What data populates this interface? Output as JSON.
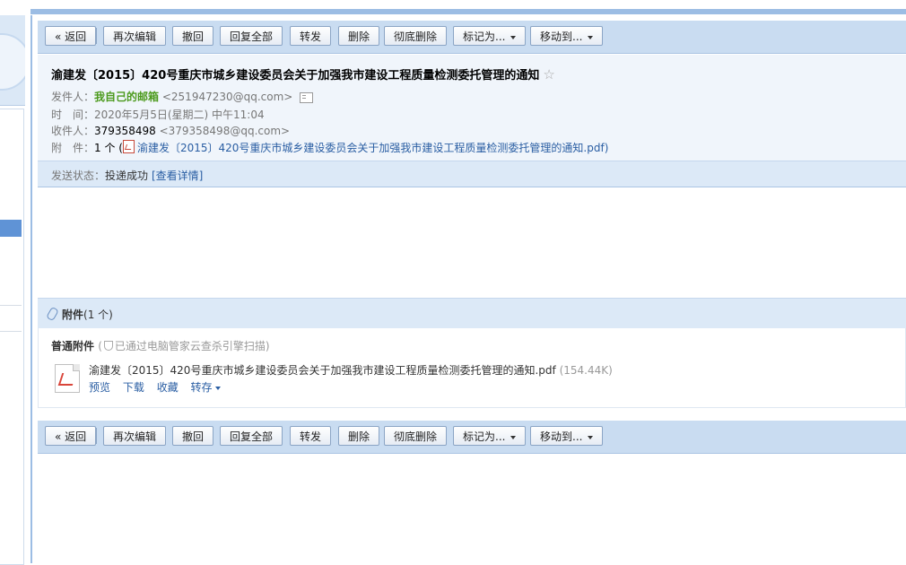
{
  "toolbar": {
    "back": "« 返回",
    "reedit": "再次编辑",
    "recall": "撤回",
    "reply_all": "回复全部",
    "forward": "转发",
    "delete": "删除",
    "delete_perm": "彻底删除",
    "mark_as": "标记为...",
    "move_to": "移动到..."
  },
  "mail": {
    "subject": "渝建发〔2015〕420号重庆市城乡建设委员会关于加强我市建设工程质量检测委托管理的通知",
    "sender_label": "发件人：",
    "sender_name": "我自己的邮箱",
    "sender_email": "<251947230@qq.com>",
    "time_label": "时　间：",
    "time": "2020年5月5日(星期二) 中午11:04",
    "to_label": "收件人：",
    "to_name": "379358498",
    "to_email": "<379358498@qq.com>",
    "attach_label": "附　件：",
    "attach_count": "1 个 (",
    "attach_name": "渝建发〔2015〕420号重庆市城乡建设委员会关于加强我市建设工程质量检测委托管理的通知.pdf",
    "attach_close": ")",
    "status_label": "发送状态：",
    "status_value": "投递成功",
    "status_link": "[查看详情]"
  },
  "attachments": {
    "title": "附件",
    "count": "(1 个)",
    "section": "普通附件",
    "scan_note_open": "(",
    "scan_note": "已通过电脑管家云查杀引擎扫描",
    "scan_note_close": ")",
    "file_name": "渝建发〔2015〕420号重庆市城乡建设委员会关于加强我市建设工程质量检测委托管理的通知.pdf",
    "file_size": "(154.44K)",
    "actions": {
      "preview": "预览",
      "download": "下载",
      "favorite": "收藏",
      "save_to": "转存"
    }
  },
  "colors": {
    "toolbar_bg": "#c9dcf1",
    "header_bg": "#f0f5fb",
    "link": "#2a5ea3",
    "sender_green": "#4c9a1d"
  }
}
